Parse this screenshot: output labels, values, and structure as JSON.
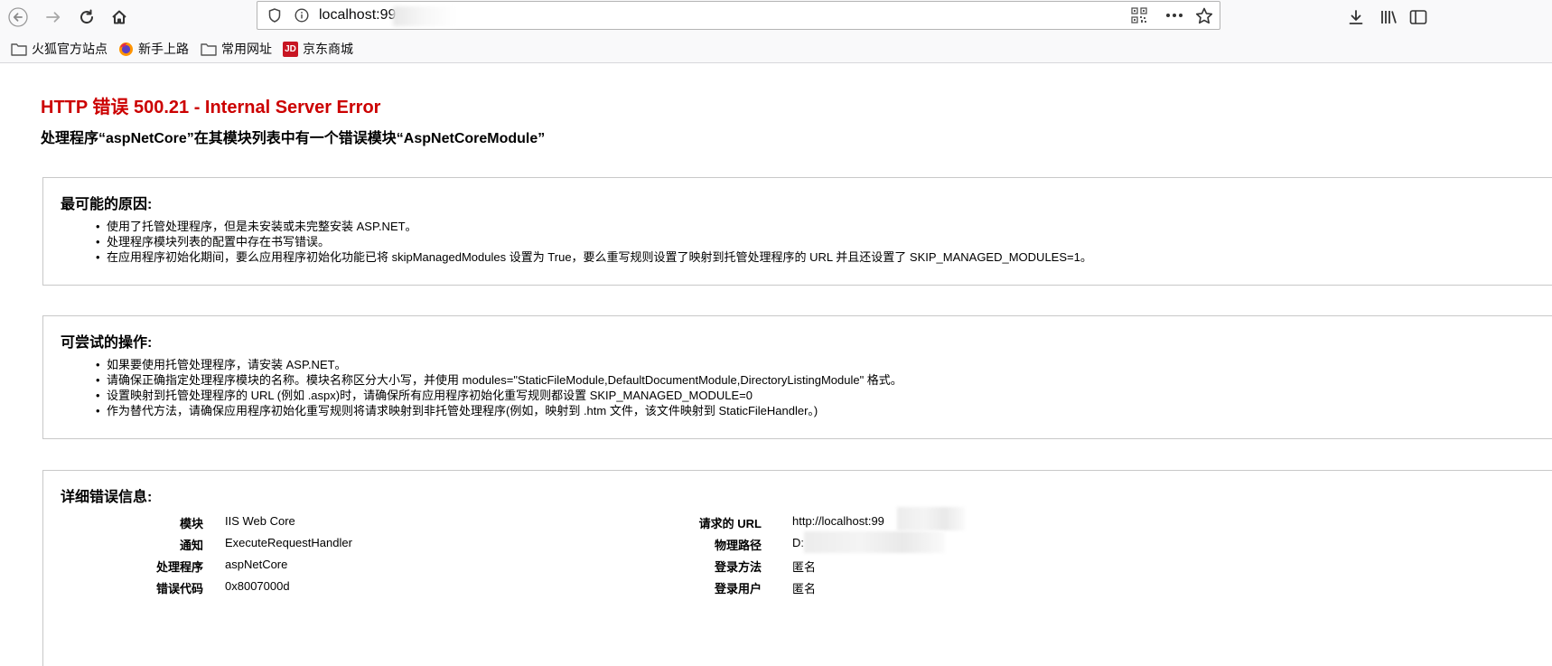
{
  "toolbar": {
    "url": "localhost:99",
    "back_icon": "back-arrow-icon",
    "forward_icon": "forward-arrow-icon",
    "reload_icon": "reload-icon",
    "home_icon": "home-icon"
  },
  "bookmarks": [
    {
      "label": "火狐官方站点",
      "icon": "folder-icon"
    },
    {
      "label": "新手上路",
      "icon": "firefox-icon"
    },
    {
      "label": "常用网址",
      "icon": "folder-icon"
    },
    {
      "label": "京东商城",
      "icon": "jd-icon",
      "icon_text": "JD"
    }
  ],
  "error": {
    "title": "HTTP 错误 500.21 - Internal Server Error",
    "subtitle": "处理程序“aspNetCore”在其模块列表中有一个错误模块“AspNetCoreModule”"
  },
  "causes": {
    "heading": "最可能的原因:",
    "items": [
      "使用了托管处理程序，但是未安装或未完整安装 ASP.NET。",
      "处理程序模块列表的配置中存在书写错误。",
      "在应用程序初始化期间，要么应用程序初始化功能已将 skipManagedModules 设置为 True，要么重写规则设置了映射到托管处理程序的 URL 并且还设置了 SKIP_MANAGED_MODULES=1。"
    ]
  },
  "actions": {
    "heading": "可尝试的操作:",
    "items": [
      "如果要使用托管处理程序，请安装 ASP.NET。",
      "请确保正确指定处理程序模块的名称。模块名称区分大小写，并使用 modules=\"StaticFileModule,DefaultDocumentModule,DirectoryListingModule\" 格式。",
      "设置映射到托管处理程序的 URL (例如 .aspx)时，请确保所有应用程序初始化重写规则都设置 SKIP_MANAGED_MODULE=0",
      "作为替代方法，请确保应用程序初始化重写规则将请求映射到非托管处理程序(例如，映射到 .htm 文件，该文件映射到 StaticFileHandler。)"
    ]
  },
  "detail": {
    "heading": "详细错误信息:",
    "left": [
      {
        "label": "模块",
        "value": "IIS Web Core"
      },
      {
        "label": "通知",
        "value": "ExecuteRequestHandler"
      },
      {
        "label": "处理程序",
        "value": "aspNetCore"
      },
      {
        "label": "错误代码",
        "value": "0x8007000d"
      }
    ],
    "right": [
      {
        "label": "请求的 URL",
        "value": "http://localhost:99"
      },
      {
        "label": "物理路径",
        "value": "D:"
      },
      {
        "label": "登录方法",
        "value": "匿名"
      },
      {
        "label": "登录用户",
        "value": "匿名"
      }
    ]
  }
}
